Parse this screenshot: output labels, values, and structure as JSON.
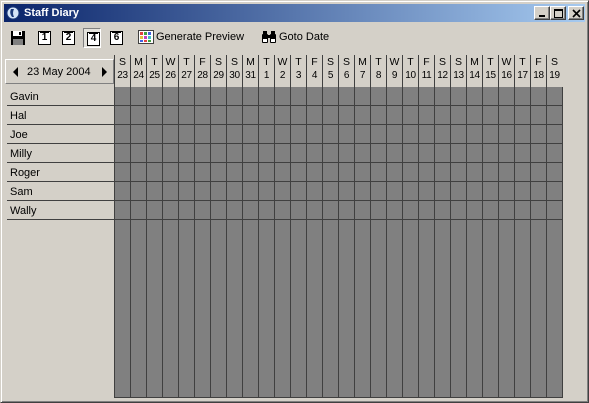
{
  "window": {
    "title": "Staff Diary"
  },
  "toolbar": {
    "save_icon": "floppy-disk-icon",
    "view_buttons": [
      "1",
      "2",
      "4",
      "6"
    ],
    "selected_view": "4",
    "generate_preview_label": "Generate Preview",
    "goto_date_label": "Goto Date"
  },
  "date_nav": {
    "current_date": "23 May 2004"
  },
  "days": [
    {
      "l": "S",
      "n": "23"
    },
    {
      "l": "M",
      "n": "24"
    },
    {
      "l": "T",
      "n": "25"
    },
    {
      "l": "W",
      "n": "26"
    },
    {
      "l": "T",
      "n": "27"
    },
    {
      "l": "F",
      "n": "28"
    },
    {
      "l": "S",
      "n": "29"
    },
    {
      "l": "S",
      "n": "30"
    },
    {
      "l": "M",
      "n": "31"
    },
    {
      "l": "T",
      "n": "1"
    },
    {
      "l": "W",
      "n": "2"
    },
    {
      "l": "T",
      "n": "3"
    },
    {
      "l": "F",
      "n": "4"
    },
    {
      "l": "S",
      "n": "5"
    },
    {
      "l": "S",
      "n": "6"
    },
    {
      "l": "M",
      "n": "7"
    },
    {
      "l": "T",
      "n": "8"
    },
    {
      "l": "W",
      "n": "9"
    },
    {
      "l": "T",
      "n": "10"
    },
    {
      "l": "F",
      "n": "11"
    },
    {
      "l": "S",
      "n": "12"
    },
    {
      "l": "S",
      "n": "13"
    },
    {
      "l": "M",
      "n": "14"
    },
    {
      "l": "T",
      "n": "15"
    },
    {
      "l": "W",
      "n": "16"
    },
    {
      "l": "T",
      "n": "17"
    },
    {
      "l": "F",
      "n": "18"
    },
    {
      "l": "S",
      "n": "19"
    }
  ],
  "staff": [
    "Gavin",
    "Hal",
    "Joe",
    "Milly",
    "Roger",
    "Sam",
    "Wally"
  ],
  "colors": {
    "grid": "#808080",
    "grid_lines": "#404040",
    "title_start": "#0a246a",
    "title_end": "#a6caf0"
  }
}
